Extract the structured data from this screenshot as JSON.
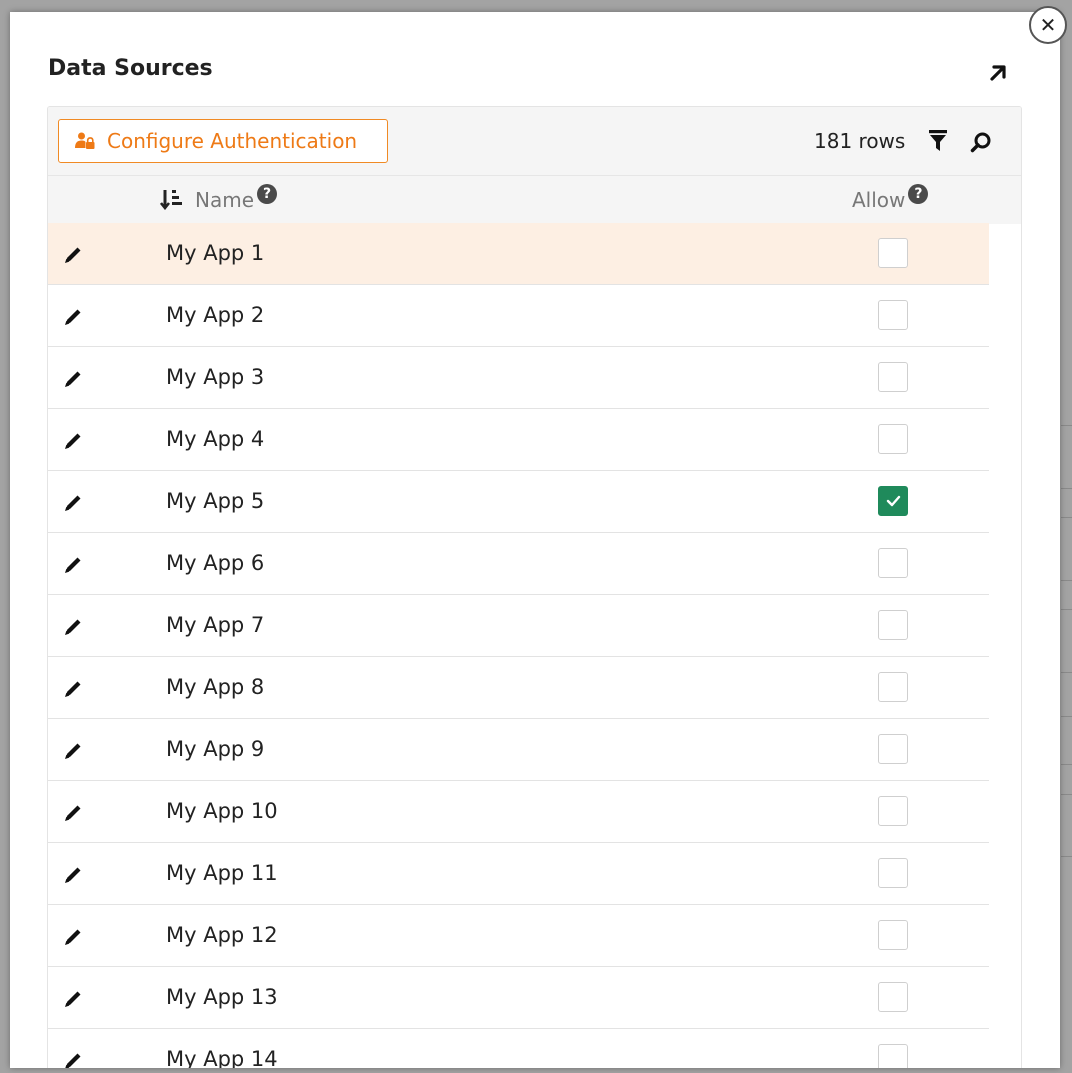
{
  "modal": {
    "title": "Data Sources",
    "close_icon": "close-icon",
    "expand_icon": "arrow-up-right-icon"
  },
  "toolbar": {
    "configure_auth_label": "Configure Authentication",
    "configure_auth_icon": "user-lock-icon",
    "accent_color": "#ee7a16",
    "row_count": "181 rows",
    "filter_icon": "filter-icon",
    "search_icon": "search-icon"
  },
  "table": {
    "columns": {
      "name": "Name",
      "allow": "Allow",
      "sort_icon": "sort-descending-icon",
      "help_icon": "question-circle-icon"
    },
    "check_color": "#1f8a5b",
    "highlight_color": "#fdefe3",
    "rows": [
      {
        "name": "My App 1",
        "allow": false,
        "highlighted": true
      },
      {
        "name": "My App 2",
        "allow": false
      },
      {
        "name": "My App 3",
        "allow": false
      },
      {
        "name": "My App 4",
        "allow": false
      },
      {
        "name": "My App 5",
        "allow": true
      },
      {
        "name": "My App 6",
        "allow": false
      },
      {
        "name": "My App 7",
        "allow": false
      },
      {
        "name": "My App 8",
        "allow": false
      },
      {
        "name": "My App 9",
        "allow": false
      },
      {
        "name": "My App 10",
        "allow": false
      },
      {
        "name": "My App 11",
        "allow": false
      },
      {
        "name": "My App 12",
        "allow": false
      },
      {
        "name": "My App 13",
        "allow": false
      },
      {
        "name": "My App 14",
        "allow": false
      }
    ]
  }
}
